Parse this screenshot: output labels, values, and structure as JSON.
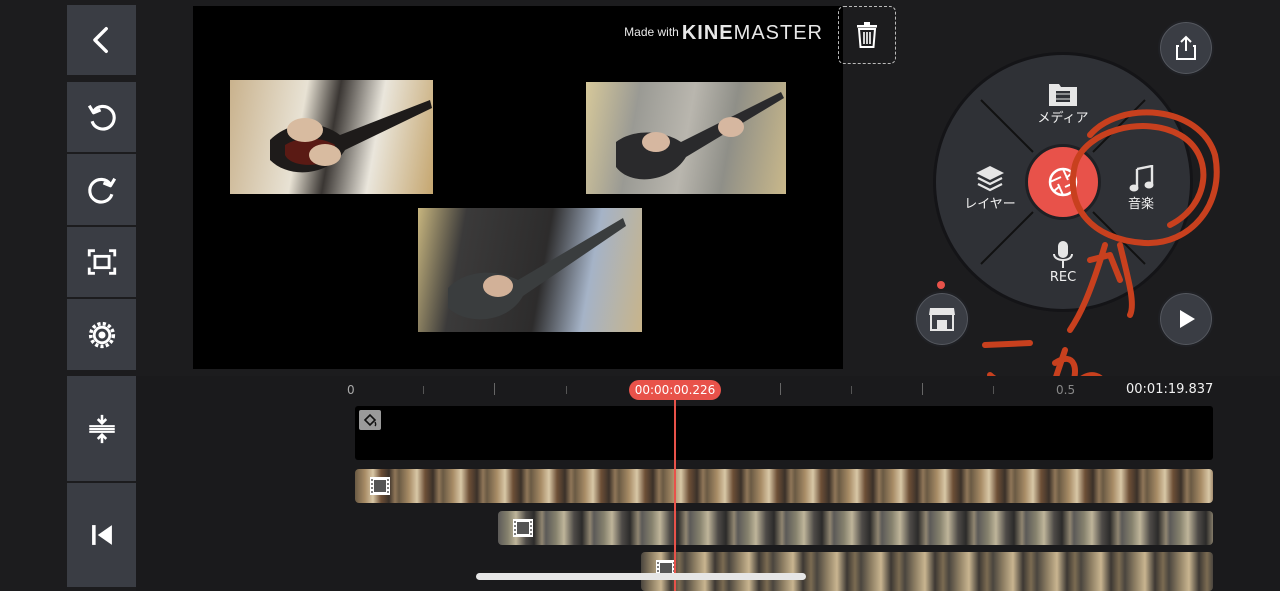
{
  "preview": {
    "watermark_small": "Made with",
    "watermark_brand_bold": "KINE",
    "watermark_brand_light": "MASTER"
  },
  "wheel": {
    "media_label": "メディア",
    "layer_label": "レイヤー",
    "audio_label": "音楽",
    "rec_label": "REC"
  },
  "timeline": {
    "ruler_start": "0",
    "ruler_mid": "0.5",
    "playhead_time": "00:00:00.226",
    "total_time": "00:01:19.837"
  },
  "annotation": {
    "handwritten_text": "これ",
    "color": "#c8401e"
  },
  "colors": {
    "accent": "#e8524a",
    "toolbar": "#3a3d44",
    "background": "#1c1c1e"
  }
}
